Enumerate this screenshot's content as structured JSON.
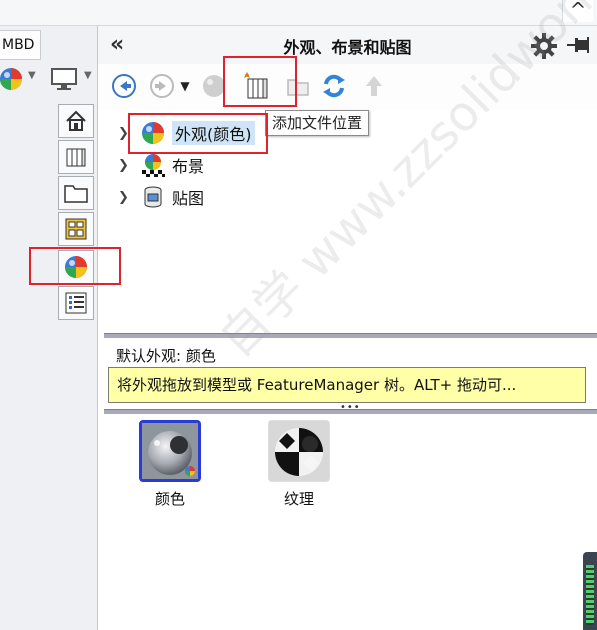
{
  "top": {
    "chevron": "^"
  },
  "left": {
    "mbd_tab": "MBD"
  },
  "panel": {
    "title": "外观、布景和贴图",
    "collapse": "«"
  },
  "tooltip": {
    "text": "添加文件位置"
  },
  "tree": {
    "items": [
      {
        "label": "外观(颜色)",
        "expanded": false,
        "selected": true,
        "icon": "appearance-ball-icon"
      },
      {
        "label": "布景",
        "expanded": false,
        "selected": false,
        "icon": "scene-icon"
      },
      {
        "label": "贴图",
        "expanded": false,
        "selected": false,
        "icon": "decal-icon"
      }
    ]
  },
  "info": {
    "default_label": "默认外观: 颜色",
    "hint": "将外观拖放到模型或 FeatureManager 树。ALT+ 拖动可...",
    "dots": "•••"
  },
  "thumbnails": [
    {
      "label": "颜色",
      "selected": true,
      "icon": "color-sphere-icon"
    },
    {
      "label": "纹理",
      "selected": false,
      "icon": "texture-sphere-icon"
    }
  ],
  "watermark": "自学 www.zzsolidworks.com",
  "colors": {
    "annotation": "#e0222c",
    "selection": "#2a3bd6",
    "hint_bg": "#ffffa8"
  }
}
